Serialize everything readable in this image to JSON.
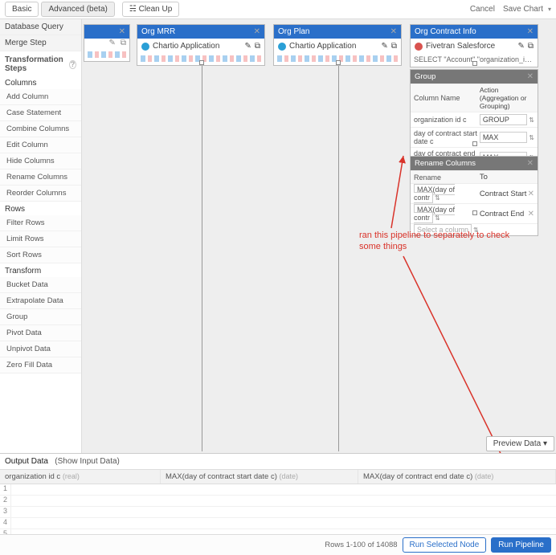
{
  "topbar": {
    "tab_basic": "Basic",
    "tab_advanced": "Advanced (beta)",
    "cleanup": "Clean Up",
    "cancel": "Cancel",
    "save": "Save Chart"
  },
  "sidebar": {
    "db_query": "Database Query",
    "merge_step": "Merge Step",
    "transformation_header": "Transformation Steps",
    "columns_header": "Columns",
    "columns": {
      "add": "Add Column",
      "case": "Case Statement",
      "combine": "Combine Columns",
      "edit": "Edit Column",
      "hide": "Hide Columns",
      "rename": "Rename Columns",
      "reorder": "Reorder Columns"
    },
    "rows_header": "Rows",
    "rows": {
      "filter": "Filter Rows",
      "limit": "Limit Rows",
      "sort": "Sort Rows"
    },
    "transform_header": "Transform",
    "transform": {
      "bucket": "Bucket Data",
      "extrapolate": "Extrapolate Data",
      "group": "Group",
      "pivot": "Pivot Data",
      "unpivot": "Unpivot Data",
      "zerofill": "Zero Fill Data"
    }
  },
  "cards": {
    "c1": {
      "title": "",
      "source": ""
    },
    "c2": {
      "title": "Org MRR",
      "source": "Chartio Application"
    },
    "c3": {
      "title": "Org Plan",
      "source": "Chartio Application"
    },
    "c4": {
      "title": "Org Contract Info",
      "source": "Fivetran Salesforce",
      "sql": "SELECT \"Account\".\"organization_id__c\" AS \"Orga..."
    }
  },
  "group_step": {
    "title": "Group",
    "col_header": "Column Name",
    "action_header": "Action (Aggregation or Grouping)",
    "rows": [
      {
        "name": "organization id c",
        "action": "GROUP"
      },
      {
        "name": "day of contract start date c",
        "action": "MAX"
      },
      {
        "name": "day of contract end date c",
        "action": "MAX"
      }
    ]
  },
  "rename_step": {
    "title": "Rename Columns",
    "rename_header": "Rename",
    "to_header": "To",
    "rows": [
      {
        "from": "MAX(day of contr",
        "to": "Contract Start"
      },
      {
        "from": "MAX(day of contr",
        "to": "Contract End"
      }
    ],
    "select_placeholder": "Select a column"
  },
  "annotation": {
    "text1": "ran this pipeline to separately to check",
    "text2": "some things"
  },
  "preview_btn": "Preview Data",
  "output": {
    "tab_output": "Output Data",
    "tab_input": "(Show Input Data)",
    "col1_name": "organization id c",
    "col1_type": "(real)",
    "col2_name": "MAX(day of contract start date c)",
    "col2_type": "(date)",
    "col3_name": "MAX(day of contract end date c)",
    "col3_type": "(date)",
    "rows_status": "Rows 1-100 of 14088",
    "run_selected": "Run Selected Node",
    "run_pipeline": "Run Pipeline"
  }
}
